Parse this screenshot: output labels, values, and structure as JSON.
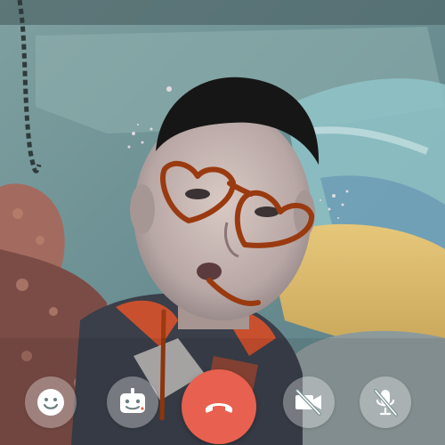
{
  "call": {
    "controls": [
      {
        "id": "emoji",
        "icon": "smiley-face-icon"
      },
      {
        "id": "effects",
        "icon": "robot-mask-icon"
      },
      {
        "id": "end-call",
        "icon": "hang-up-phone-icon"
      },
      {
        "id": "video-toggle",
        "icon": "video-off-icon",
        "state": "off"
      },
      {
        "id": "mic-toggle",
        "icon": "mic-off-icon",
        "state": "muted"
      }
    ]
  },
  "colors": {
    "end_call": "#e8604f",
    "control_bg": "rgba(255,255,255,0.32)",
    "icon_white": "#ffffff",
    "face_filter_stroke": "#9a3a10"
  }
}
